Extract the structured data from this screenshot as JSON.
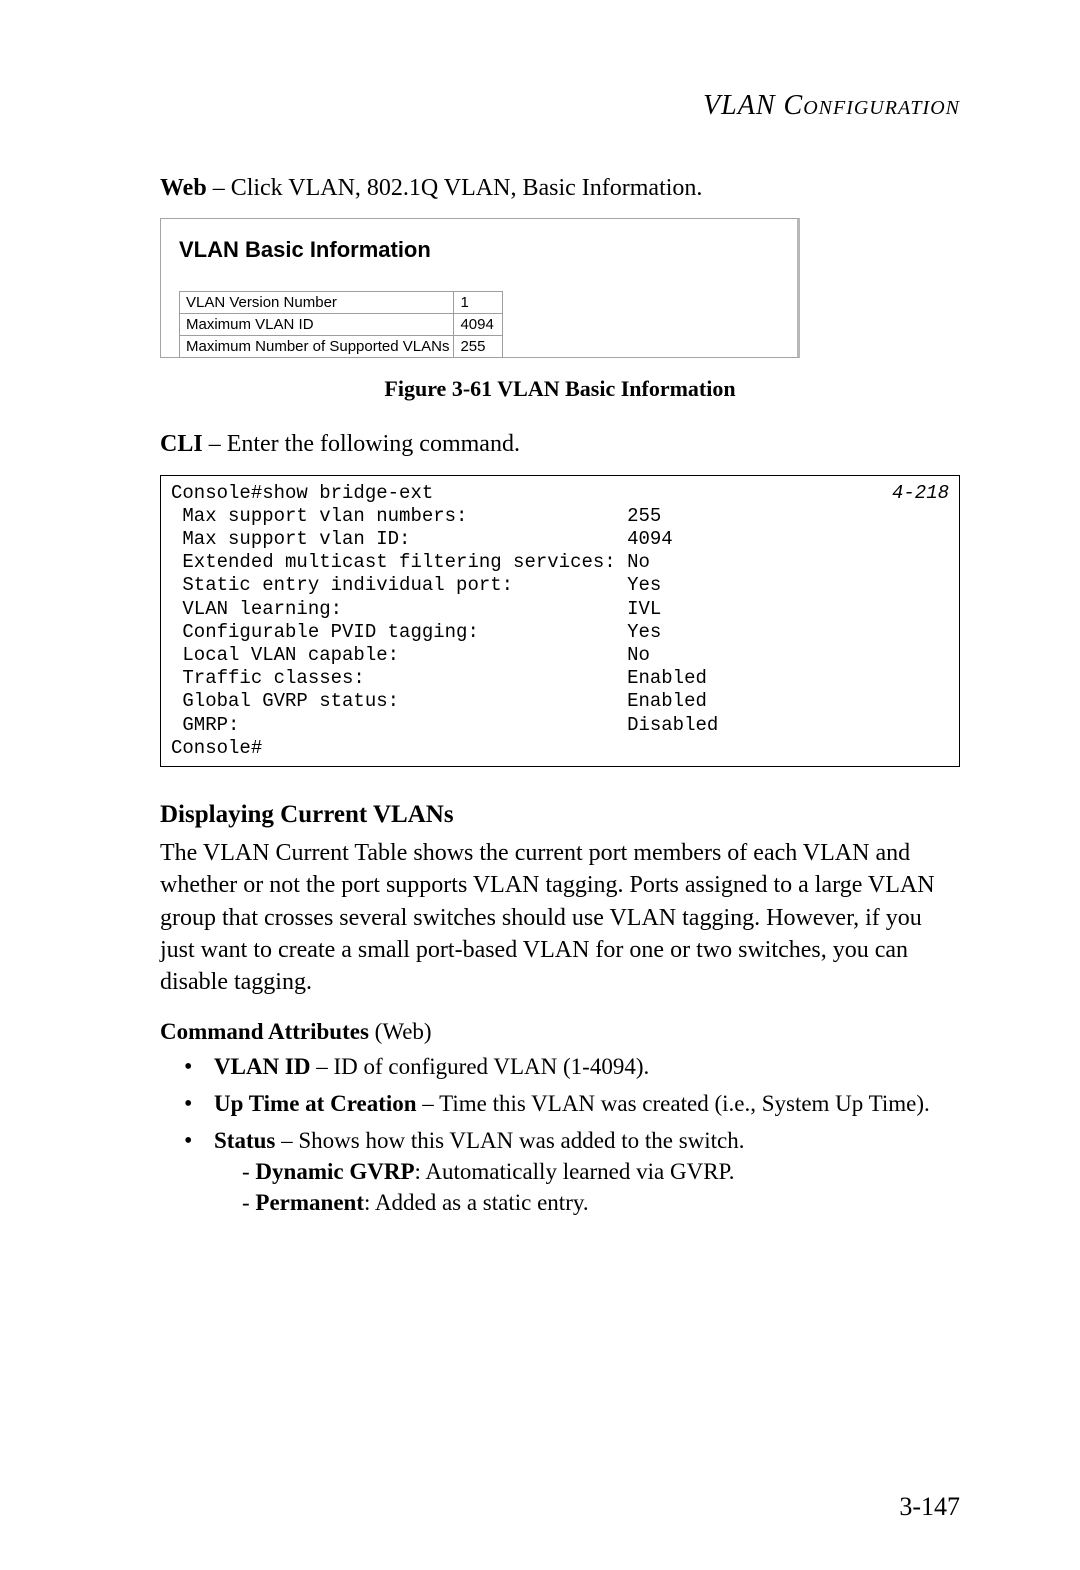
{
  "header": {
    "running_head": "VLAN Configuration"
  },
  "intro": {
    "web_label": "Web",
    "web_text": " – Click VLAN, 802.1Q VLAN, Basic Information."
  },
  "ui": {
    "panel_title": "VLAN Basic Information",
    "rows": [
      {
        "label": "VLAN Version Number",
        "value": "1"
      },
      {
        "label": "Maximum VLAN ID",
        "value": "4094"
      },
      {
        "label": "Maximum Number of Supported VLANs",
        "value": "255"
      }
    ]
  },
  "figure": {
    "caption": "Figure 3-61  VLAN Basic Information"
  },
  "cli": {
    "label": "CLI",
    "text": " – Enter the following command.",
    "ref": "4-218",
    "output": "Console#show bridge-ext\n Max support vlan numbers:              255\n Max support vlan ID:                   4094\n Extended multicast filtering services: No\n Static entry individual port:          Yes\n VLAN learning:                         IVL\n Configurable PVID tagging:             Yes\n Local VLAN capable:                    No\n Traffic classes:                       Enabled\n Global GVRP status:                    Enabled\n GMRP:                                  Disabled\nConsole#"
  },
  "section": {
    "heading": "Displaying Current VLANs",
    "body": "The VLAN Current Table shows the current port members of each VLAN and whether or not the port supports VLAN tagging. Ports assigned to a large VLAN group that crosses several switches should use VLAN tagging. However, if you just want to create a small port-based VLAN for one or two switches, you can disable tagging."
  },
  "attrs": {
    "heading_strong": "Command Attributes",
    "heading_rest": " (Web)",
    "items": [
      {
        "term": "VLAN ID",
        "desc": " – ID of configured VLAN (1-4094)."
      },
      {
        "term": "Up Time at Creation",
        "desc": " – Time this VLAN was created (i.e., System Up Time)."
      },
      {
        "term": "Status",
        "desc": " – Shows how this VLAN was added to the switch.",
        "subs": [
          {
            "term": "Dynamic GVRP",
            "desc": ": Automatically learned via GVRP."
          },
          {
            "term": "Permanent",
            "desc": ": Added as a static entry."
          }
        ]
      }
    ]
  },
  "page_number": "3-147"
}
